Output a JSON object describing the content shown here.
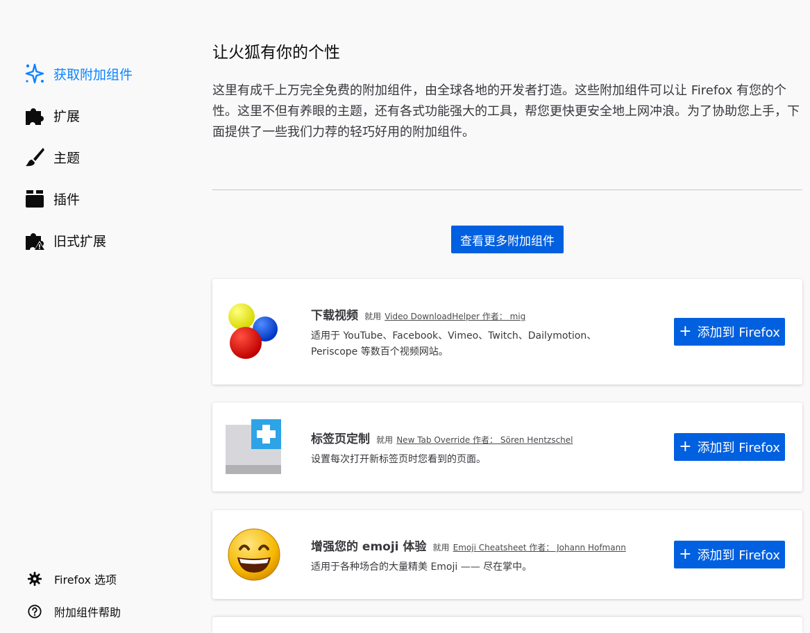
{
  "sidebar": {
    "items": [
      {
        "label": "获取附加组件",
        "icon": "sparkle-icon",
        "active": true
      },
      {
        "label": "扩展",
        "icon": "puzzle-icon"
      },
      {
        "label": "主题",
        "icon": "brush-icon"
      },
      {
        "label": "插件",
        "icon": "plugin-icon"
      },
      {
        "label": "旧式扩展",
        "icon": "puzzle-warning-icon"
      }
    ],
    "footer": [
      {
        "label": "Firefox 选项",
        "icon": "gear-icon"
      },
      {
        "label": "附加组件帮助",
        "icon": "help-icon"
      }
    ]
  },
  "main": {
    "title": "让火狐有你的个性",
    "description": "这里有成千上万完全免费的附加组件，由全球各地的开发者打造。这些附加组件可以让 Firefox 有您的个性。这里不但有养眼的主题，还有各式功能强大的工具，帮您更快更安全地上网冲浪。为了协助您上手，下面提供了一些我们力荐的轻巧好用的附加组件。",
    "more_button": "查看更多附加组件",
    "cards": [
      {
        "name": "下载视频",
        "by": "就用",
        "link": "Video DownloadHelper 作者： mig",
        "desc": "适用于 YouTube、Facebook、Vimeo、Twitch、Dailymotion、Periscope 等数百个视频网站。",
        "button": "添加到 Firefox",
        "icon": "video-downloadhelper-icon"
      },
      {
        "name": "标签页定制",
        "by": "就用",
        "link": "New Tab Override 作者： Sören Hentzschel",
        "desc": "设置每次打开新标签页时您看到的页面。",
        "button": "添加到 Firefox",
        "icon": "new-tab-override-icon"
      },
      {
        "name": "增强您的 emoji 体验",
        "by": "就用",
        "link": "Emoji Cheatsheet 作者： Johann Hofmann",
        "desc": "适用于各种场合的大量精美 Emoji —— 尽在掌中。",
        "button": "添加到 Firefox",
        "icon": "emoji-icon"
      }
    ]
  },
  "colors": {
    "accent": "#0060df",
    "active": "#0a84ff"
  }
}
